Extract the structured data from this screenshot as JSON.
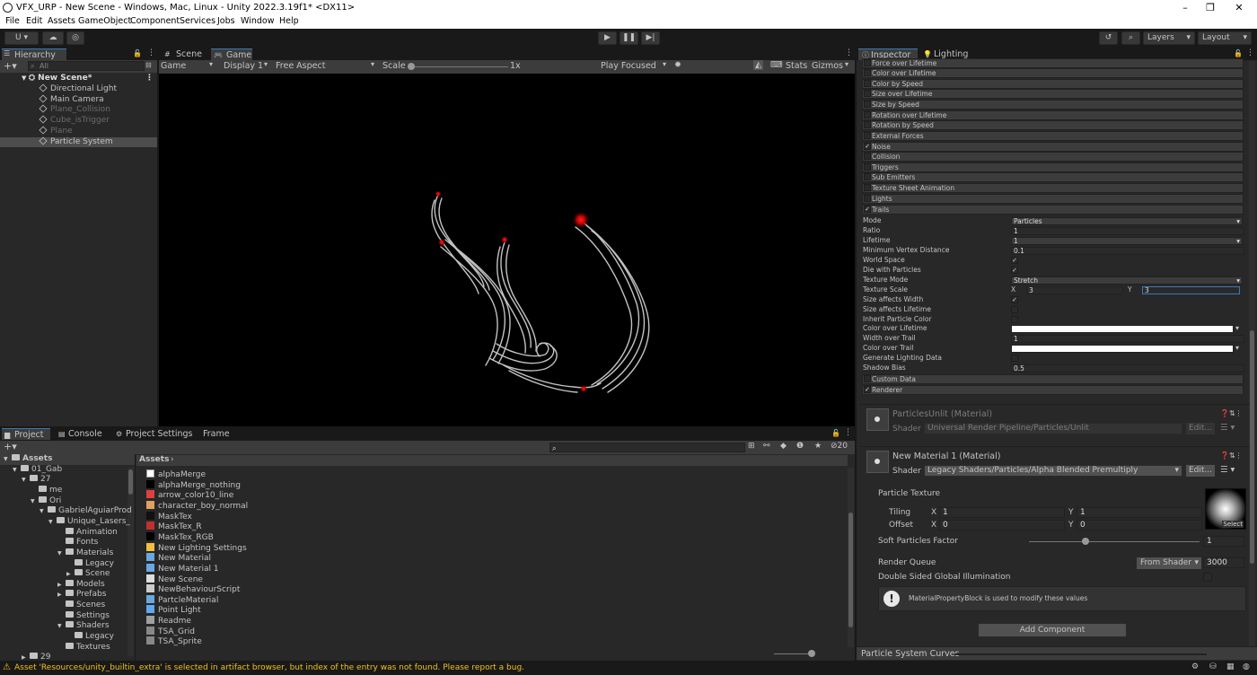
{
  "title": "VFX_URP - New Scene - Windows, Mac, Linux - Unity 2022.3.19f1* <DX11>",
  "menu": [
    "File",
    "Edit",
    "Assets",
    "GameObject",
    "Component",
    "Services",
    "Jobs",
    "Window",
    "Help"
  ],
  "window_controls": {
    "min": "–",
    "max": "❐",
    "close": "✕"
  },
  "toolbar": {
    "account": "U ▾",
    "layers": "Layers",
    "layout": "Layout"
  },
  "hierarchy": {
    "tab": "Hierarchy",
    "search_placeholder": "All",
    "scene": "New Scene*",
    "items": [
      {
        "label": "Directional Light",
        "dim": false
      },
      {
        "label": "Main Camera",
        "dim": false
      },
      {
        "label": "Plane_Collision",
        "dim": true
      },
      {
        "label": "Cube_isTrigger",
        "dim": true
      },
      {
        "label": "Plane",
        "dim": true
      },
      {
        "label": "Particle System",
        "dim": false,
        "selected": true
      }
    ]
  },
  "view_tabs": {
    "scene": "Scene",
    "game": "Game"
  },
  "game_bar": {
    "mode": "Game",
    "display": "Display 1",
    "aspect": "Free Aspect",
    "scale_label": "Scale",
    "scale_value": "1x",
    "play_focused": "Play Focused",
    "stats": "Stats",
    "gizmos": "Gizmos"
  },
  "inspector": {
    "tab": "Inspector",
    "lighting_tab": "Lighting",
    "modules": [
      {
        "label": "Force over Lifetime",
        "checked": false
      },
      {
        "label": "Color over Lifetime",
        "checked": false
      },
      {
        "label": "Color by Speed",
        "checked": false
      },
      {
        "label": "Size over Lifetime",
        "checked": false
      },
      {
        "label": "Size by Speed",
        "checked": false
      },
      {
        "label": "Rotation over Lifetime",
        "checked": false
      },
      {
        "label": "Rotation by Speed",
        "checked": false
      },
      {
        "label": "External Forces",
        "checked": false
      },
      {
        "label": "Noise",
        "checked": true
      },
      {
        "label": "Collision",
        "checked": false
      },
      {
        "label": "Triggers",
        "checked": false
      },
      {
        "label": "Sub Emitters",
        "checked": false
      },
      {
        "label": "Texture Sheet Animation",
        "checked": false
      },
      {
        "label": "Lights",
        "checked": false
      },
      {
        "label": "Trails",
        "checked": true
      }
    ],
    "trails": {
      "mode_label": "Mode",
      "mode": "Particles",
      "ratio_label": "Ratio",
      "ratio": "1",
      "lifetime_label": "Lifetime",
      "lifetime": "1",
      "min_vertex_label": "Minimum Vertex Distance",
      "min_vertex": "0.1",
      "world_space_label": "World Space",
      "world_space": true,
      "die_label": "Die with Particles",
      "die": true,
      "tex_mode_label": "Texture Mode",
      "tex_mode": "Stretch",
      "tex_scale_label": "Texture Scale",
      "tex_scale_x": "3",
      "tex_scale_y": "3",
      "size_width_label": "Size affects Width",
      "size_width": true,
      "size_life_label": "Size affects Lifetime",
      "size_life": false,
      "inherit_label": "Inherit Particle Color",
      "inherit": false,
      "col_life_label": "Color over Lifetime",
      "width_trail_label": "Width over Trail",
      "width_trail": "1",
      "col_trail_label": "Color over Trail",
      "gen_light_label": "Generate Lighting Data",
      "gen_light": false,
      "shadow_bias_label": "Shadow Bias",
      "shadow_bias": "0.5"
    },
    "custom_data": {
      "label": "Custom Data",
      "checked": false
    },
    "renderer": {
      "label": "Renderer",
      "checked": true
    },
    "mat1": {
      "name": "ParticlesUnlit (Material)",
      "shader_label": "Shader",
      "shader": "Universal Render Pipeline/Particles/Unlit",
      "edit": "Edit..."
    },
    "mat2": {
      "name": "New Material 1 (Material)",
      "shader_label": "Shader",
      "shader": "Legacy Shaders/Particles/Alpha Blended Premultiply",
      "edit": "Edit..."
    },
    "particle_texture": "Particle Texture",
    "tiling": "Tiling",
    "offset": "Offset",
    "tiling_x": "1",
    "tiling_y": "1",
    "offset_x": "0",
    "offset_y": "0",
    "select": "Select",
    "soft_label": "Soft Particles Factor",
    "soft_value": "1",
    "soft_fraction": 0.33,
    "rq_label": "Render Queue",
    "rq_mode": "From Shader",
    "rq_value": "3000",
    "dsgi_label": "Double Sided Global Illumination",
    "info": "MaterialPropertyBlock is used to modify these values",
    "add_component": "Add Component",
    "curves": "Particle System Curves"
  },
  "project": {
    "tabs": [
      "Project",
      "Console",
      "Project Settings",
      "Frame Debugger"
    ],
    "hidden_count": "20",
    "tree": [
      {
        "label": "Assets",
        "depth": 0,
        "bold": true
      },
      {
        "label": "01_Gab",
        "depth": 1
      },
      {
        "label": "27",
        "depth": 2
      },
      {
        "label": "me",
        "depth": 3
      },
      {
        "label": "Ori",
        "depth": 3
      },
      {
        "label": "GabrielAguiarProd",
        "depth": 4
      },
      {
        "label": "Unique_Lasers_",
        "depth": 5
      },
      {
        "label": "Animation",
        "depth": 6
      },
      {
        "label": "Fonts",
        "depth": 6
      },
      {
        "label": "Materials",
        "depth": 6
      },
      {
        "label": "Legacy",
        "depth": 7
      },
      {
        "label": "Scene",
        "depth": 7
      },
      {
        "label": "Models",
        "depth": 6
      },
      {
        "label": "Prefabs",
        "depth": 6
      },
      {
        "label": "Scenes",
        "depth": 6
      },
      {
        "label": "Settings",
        "depth": 6
      },
      {
        "label": "Shaders",
        "depth": 6
      },
      {
        "label": "Legacy",
        "depth": 7
      },
      {
        "label": "Textures",
        "depth": 6
      },
      {
        "label": "29",
        "depth": 2
      }
    ],
    "breadcrumb": "Assets",
    "assets": [
      {
        "label": "alphaMerge",
        "icon": "#ffffff"
      },
      {
        "label": "alphaMerge_nothing",
        "icon": "#000000"
      },
      {
        "label": "arrow_color10_line",
        "icon": "#e04040"
      },
      {
        "label": "character_boy_normal",
        "icon": "#e0a060"
      },
      {
        "label": "MaskTex",
        "icon": "#111111"
      },
      {
        "label": "MaskTex_R",
        "icon": "#c03030"
      },
      {
        "label": "MaskTex_RGB",
        "icon": "#000000"
      },
      {
        "label": "New Lighting Settings",
        "icon": "#f0c040"
      },
      {
        "label": "New Material",
        "icon": "#6aa8e0"
      },
      {
        "label": "New Material 1",
        "icon": "#6aa8e0"
      },
      {
        "label": "New Scene",
        "icon": "#dddddd"
      },
      {
        "label": "NewBehaviourScript",
        "icon": "#cccccc"
      },
      {
        "label": "PartcleMaterial",
        "icon": "#6aa8e0"
      },
      {
        "label": "Point Light",
        "icon": "#60a8f0"
      },
      {
        "label": "Readme",
        "icon": "#a0a0a0"
      },
      {
        "label": "TSA_Grid",
        "icon": "#888888"
      },
      {
        "label": "TSA_Sprite",
        "icon": "#888888"
      }
    ]
  },
  "status": "Asset 'Resources/unity_builtin_extra' is selected in artifact browser, but index of the entry was not found. Please report a bug."
}
